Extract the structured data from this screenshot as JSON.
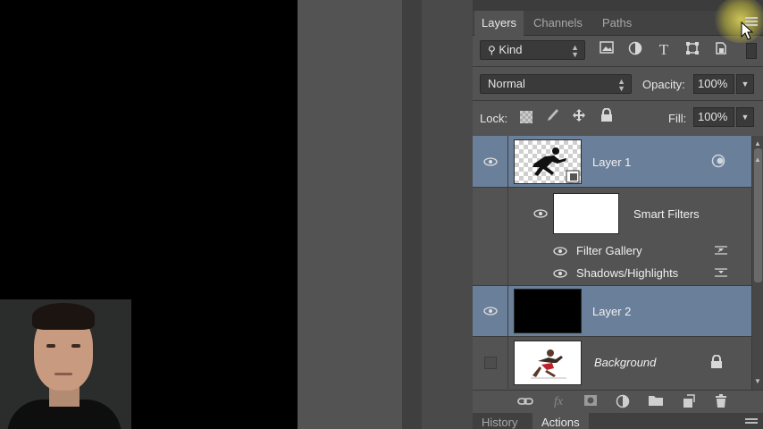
{
  "panel": {
    "tabs": [
      {
        "label": "Layers",
        "active": true
      },
      {
        "label": "Channels",
        "active": false
      },
      {
        "label": "Paths",
        "active": false
      }
    ],
    "filter": {
      "label": "Kind",
      "icons": [
        "image-filter-icon",
        "adjustment-filter-icon",
        "type-filter-icon",
        "shape-filter-icon",
        "smart-object-filter-icon"
      ]
    },
    "blend_mode": "Normal",
    "opacity_label": "Opacity:",
    "opacity_value": "100%",
    "lock_label": "Lock:",
    "fill_label": "Fill:",
    "fill_value": "100%"
  },
  "layers": {
    "layer1": {
      "name": "Layer 1",
      "visible": true,
      "selected": true
    },
    "smart_filters": {
      "name": "Smart Filters"
    },
    "filter_gallery": {
      "name": "Filter Gallery"
    },
    "shadows_highlights": {
      "name": "Shadows/Highlights"
    },
    "layer2": {
      "name": "Layer 2",
      "visible": true,
      "selected": true
    },
    "background": {
      "name": "Background",
      "visible": false,
      "locked": true
    }
  },
  "bottom_tabs": [
    {
      "label": "History",
      "active": false
    },
    {
      "label": "Actions",
      "active": true
    }
  ],
  "colors": {
    "panel_bg": "#535353",
    "selection": "#6a7f9a",
    "highlight": "#e6dc5a"
  }
}
